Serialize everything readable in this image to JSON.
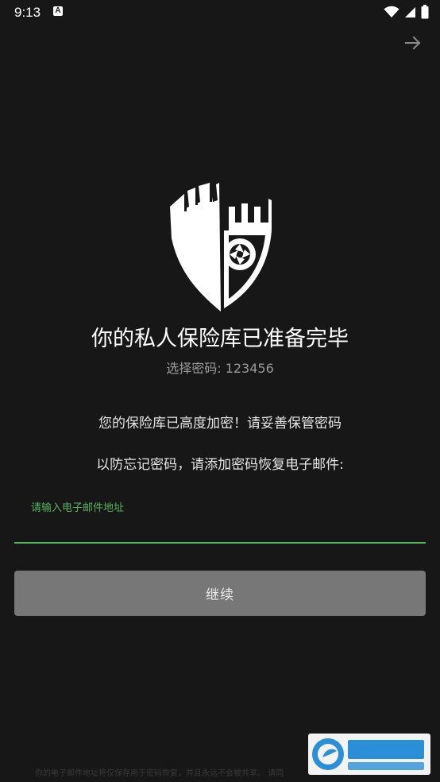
{
  "status_bar": {
    "time": "9:13",
    "notification_icon": "a-letter-icon",
    "icons": [
      "wifi-icon",
      "cellular-signal-icon",
      "battery-icon"
    ]
  },
  "header": {
    "next_icon": "arrow-right-icon"
  },
  "logo": {
    "icon": "castle-shield-camera-icon"
  },
  "vault": {
    "title": "你的私人保险库已准备完毕",
    "password_hint": "选择密码: 123456",
    "encrypt_note": "您的保险库已高度加密！请妥善保管密码",
    "recovery_note": "以防忘记密码，请添加密码恢复电子邮件:"
  },
  "email": {
    "label": "请输入电子邮件地址",
    "value": "",
    "placeholder": ""
  },
  "continue_button": {
    "label": "继续"
  },
  "footer": {
    "note": "你的电子邮件地址将仅保存用于密码恢复，并且永远不会被共享。 请同"
  },
  "watermark": {
    "icon": "fxxz-logo-icon"
  },
  "colors": {
    "background": "#171717",
    "accent": "#58b35e",
    "button": "#777777"
  }
}
